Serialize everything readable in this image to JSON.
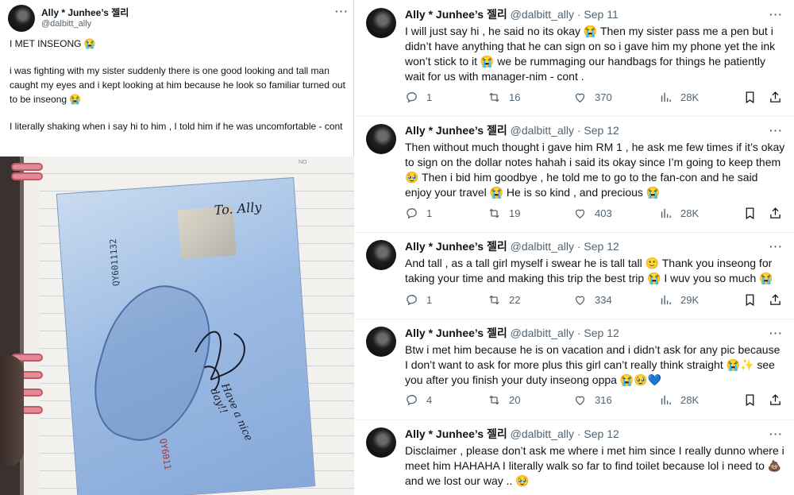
{
  "left_post": {
    "name": "Ally * Junhee’s 젤리",
    "handle": "@dalbitt_ally",
    "paragraphs": [
      "I MET INSEONG 😭",
      "i was fighting with my sister suddenly there is one good looking and tall man caught my eyes and i kept looking at him because he look so familiar turned out to be inseong 😭",
      "I literally shaking when i say hi to him , I told him if he was uncomfortable - cont"
    ],
    "image": {
      "note_text": "To. Ally",
      "serial": "QY6011132",
      "serial_bottom": "QY6011",
      "signature_lines": [
        "Have",
        "a",
        "nice",
        "day!!"
      ],
      "notebook_label": "NO"
    }
  },
  "thread": [
    {
      "name": "Ally * Junhee’s 젤리",
      "meta": "@dalbitt_ally · Sep 11",
      "text": "I will just say hi , he said no its okay 😭 Then my sister pass me a pen but i didn’t have anything that he can sign on so i gave him my phone yet the ink won’t stick to it 😭 we be rummaging our handbags for things he patiently wait for us with manager-nim - cont .",
      "replies": "1",
      "reposts": "16",
      "likes": "370",
      "views": "28K"
    },
    {
      "name": "Ally * Junhee’s 젤리",
      "meta": "@dalbitt_ally · Sep 12",
      "text": "Then without much thought i gave him RM 1 , he ask me few times if it’s okay to sign on the dollar notes hahah i said its okay since I’m going to keep them 🥹 Then i bid him goodbye , he told me to go to the fan-con and he said enjoy your travel 😭 He is so kind , and precious 😭",
      "replies": "1",
      "reposts": "19",
      "likes": "403",
      "views": "28K"
    },
    {
      "name": "Ally * Junhee’s 젤리",
      "meta": "@dalbitt_ally · Sep 12",
      "text": "And tall , as a tall girl myself i swear he is tall tall 🙂 Thank you inseong for taking your time and making this trip the best trip 😭 I wuv you so much 😭",
      "replies": "1",
      "reposts": "22",
      "likes": "334",
      "views": "29K"
    },
    {
      "name": "Ally * Junhee’s 젤리",
      "meta": "@dalbitt_ally · Sep 12",
      "text": "Btw i met him because he is on vacation and i didn’t ask for any pic because I don’t want to ask for more plus this girl can’t really think straight 😭✨ see you after you finish your duty inseong oppa 😭🥹💙",
      "replies": "4",
      "reposts": "20",
      "likes": "316",
      "views": "28K"
    },
    {
      "name": "Ally * Junhee’s 젤리",
      "meta": "@dalbitt_ally · Sep 12",
      "text": "Disclaimer , please don’t ask me where i met him since I really dunno where i meet him HAHAHA I literally walk so far to find toilet because lol i need to 💩 and we lost our way .. 🥹",
      "replies": "",
      "reposts": "",
      "likes": "",
      "views": ""
    }
  ],
  "icons": {
    "more": "more-dots-icon",
    "reply": "reply-icon",
    "repost": "repost-icon",
    "like": "like-icon",
    "views": "views-icon",
    "bookmark": "bookmark-icon",
    "share": "share-icon"
  }
}
